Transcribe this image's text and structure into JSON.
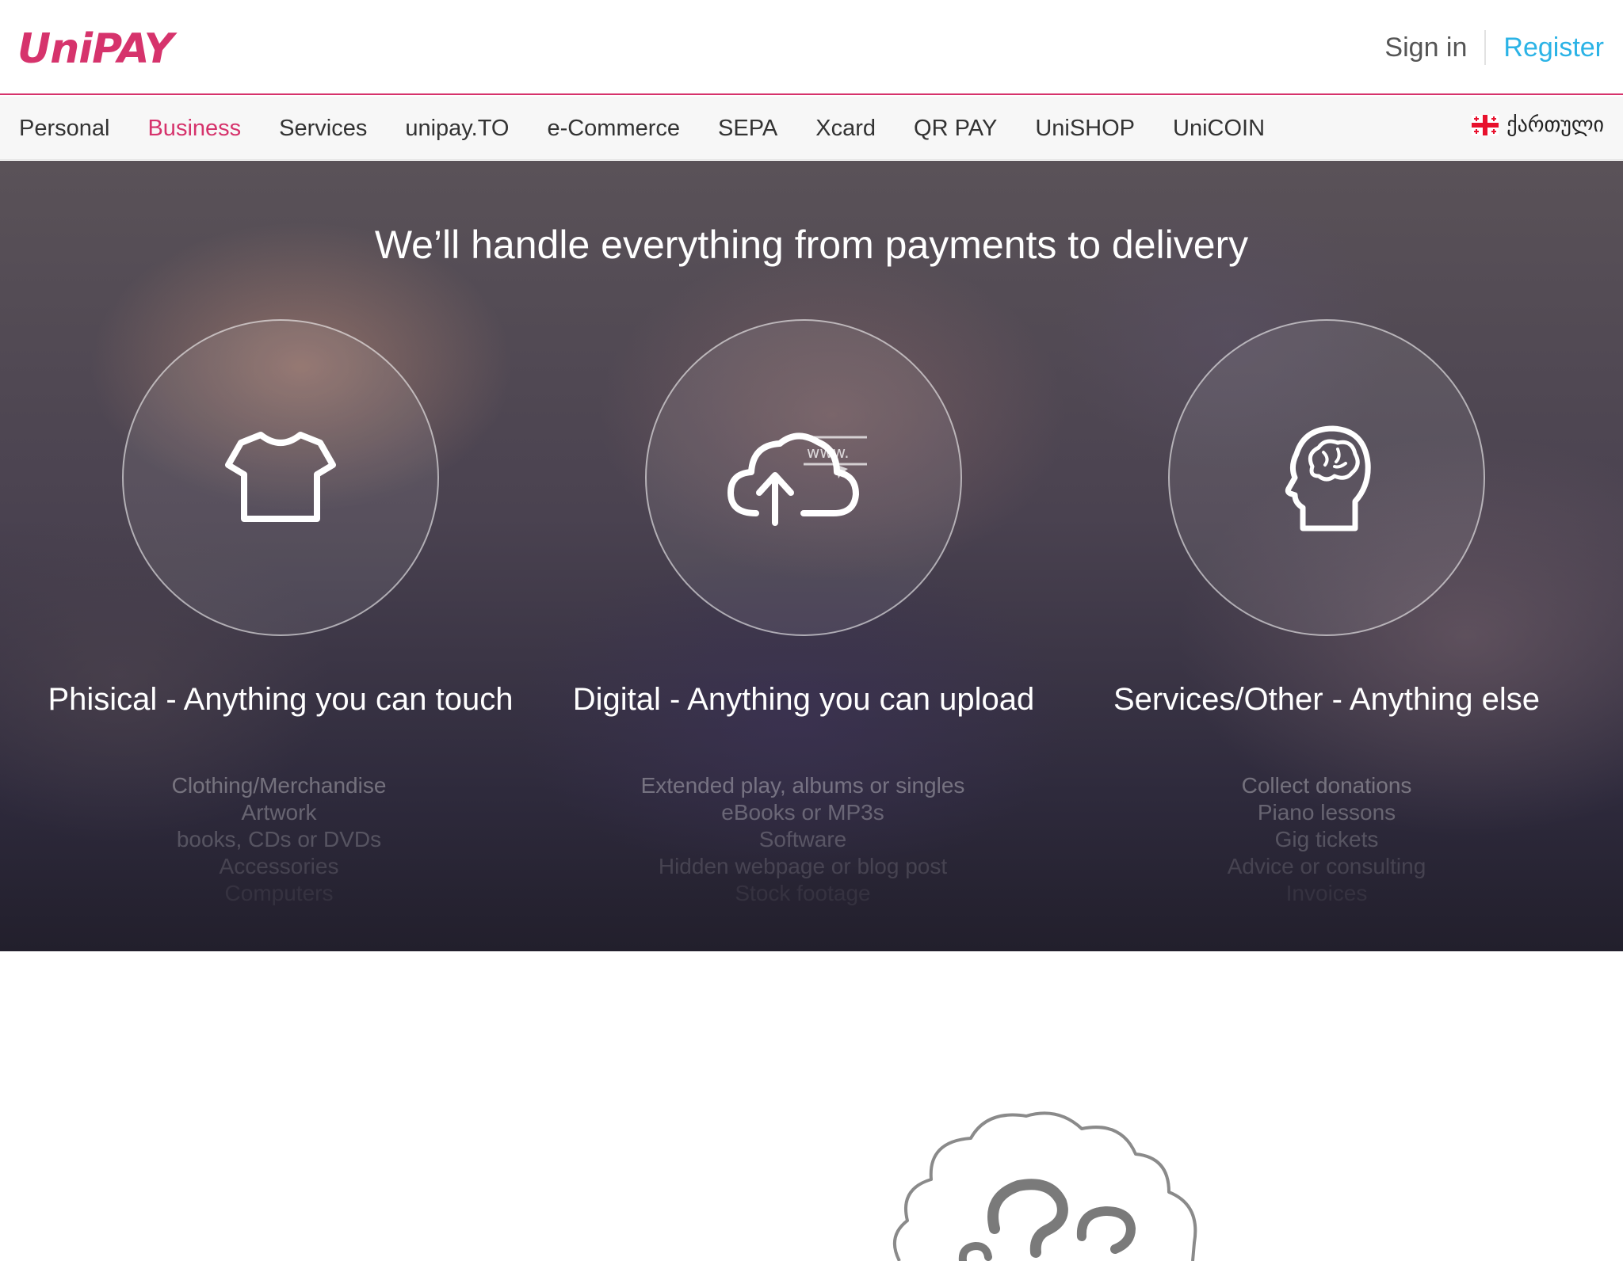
{
  "header": {
    "logo": "UniPAY",
    "sign_in": "Sign in",
    "register": "Register"
  },
  "nav": {
    "items": [
      {
        "label": "Personal",
        "active": false
      },
      {
        "label": "Business",
        "active": true
      },
      {
        "label": "Services",
        "active": false
      },
      {
        "label": "unipay.TO",
        "active": false
      },
      {
        "label": "e-Commerce",
        "active": false
      },
      {
        "label": "SEPA",
        "active": false
      },
      {
        "label": "Xcard",
        "active": false
      },
      {
        "label": "QR PAY",
        "active": false
      },
      {
        "label": "UniSHOP",
        "active": false
      },
      {
        "label": "UniCOIN",
        "active": false
      }
    ],
    "language": "ქართული",
    "language_icon": "georgian-flag-icon"
  },
  "hero": {
    "title": "We’ll handle everything from payments to delivery",
    "columns": [
      {
        "icon": "t-shirt-icon",
        "title": "Phisical - Anything you can touch",
        "items": [
          "Clothing/Merchandise",
          "Artwork",
          "books, CDs or DVDs",
          "Accessories",
          "Computers"
        ]
      },
      {
        "icon": "cloud-upload-icon",
        "icon_text": "www.",
        "title": "Digital - Anything you can upload",
        "items": [
          "Extended play, albums or singles",
          "eBooks or MP3s",
          "Software",
          "Hidden webpage or blog post",
          "Stock footage"
        ]
      },
      {
        "icon": "brain-head-icon",
        "title": "Services/Other - Anything else",
        "items": [
          "Collect donations",
          "Piano lessons",
          "Gig tickets",
          "Advice or consulting",
          "Invoices"
        ]
      }
    ]
  },
  "lower": {
    "illustration": "question-cloud-icon"
  },
  "colors": {
    "brand": "#d6336c",
    "link": "#2bb3e6"
  }
}
